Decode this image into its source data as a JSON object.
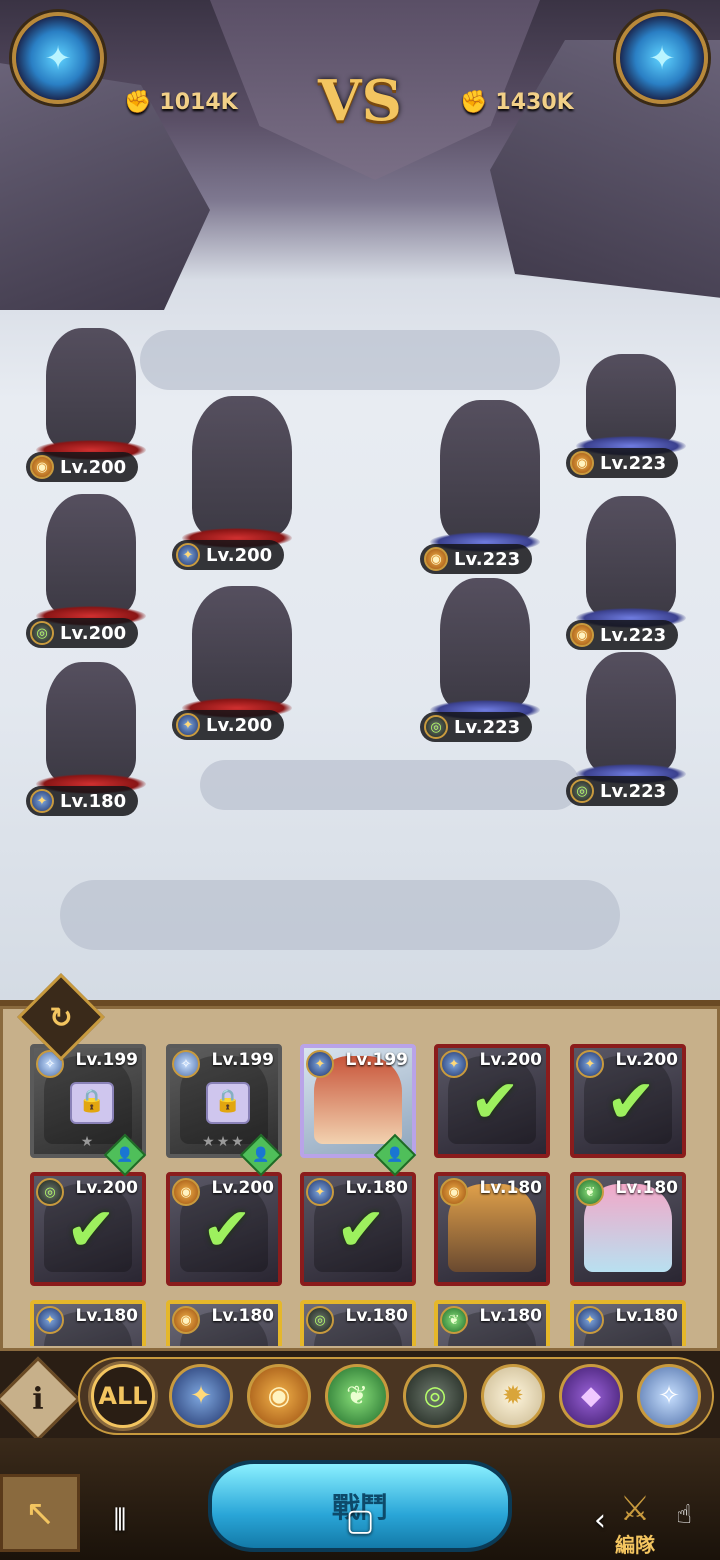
{
  "header": {
    "vs_label": "VS",
    "left_power": "1014K",
    "right_power": "1430K"
  },
  "allies": [
    {
      "level": "Lv.200",
      "faction": "mauler"
    },
    {
      "level": "Lv.200",
      "faction": "lightbearer"
    },
    {
      "level": "Lv.200",
      "faction": "graveborn"
    },
    {
      "level": "Lv.200",
      "faction": "lightbearer"
    },
    {
      "level": "Lv.180",
      "faction": "lightbearer"
    }
  ],
  "enemies": [
    {
      "level": "Lv.223",
      "faction": "mauler"
    },
    {
      "level": "Lv.223",
      "faction": "mauler"
    },
    {
      "level": "Lv.223",
      "faction": "mauler"
    },
    {
      "level": "Lv.223",
      "faction": "graveborn"
    },
    {
      "level": "Lv.223",
      "faction": "graveborn"
    }
  ],
  "roster": [
    {
      "level": "Lv.199",
      "state": "locked",
      "stars": "★",
      "assist": true
    },
    {
      "level": "Lv.199",
      "state": "locked",
      "stars": "★★★",
      "assist": true
    },
    {
      "level": "Lv.199",
      "state": "available",
      "stars": "",
      "assist": true
    },
    {
      "level": "Lv.200",
      "state": "selected",
      "stars": "",
      "assist": false
    },
    {
      "level": "Lv.200",
      "state": "selected",
      "stars": "",
      "assist": false
    },
    {
      "level": "Lv.200",
      "state": "selected",
      "stars": "",
      "assist": false
    },
    {
      "level": "Lv.200",
      "state": "selected",
      "stars": "",
      "assist": false
    },
    {
      "level": "Lv.180",
      "state": "selected",
      "stars": "",
      "assist": false
    },
    {
      "level": "Lv.180",
      "state": "available",
      "stars": "",
      "assist": false
    },
    {
      "level": "Lv.180",
      "state": "available",
      "stars": "",
      "assist": false
    },
    {
      "level": "Lv.180",
      "state": "available",
      "stars": "",
      "assist": false
    },
    {
      "level": "Lv.180",
      "state": "available",
      "stars": "",
      "assist": false
    },
    {
      "level": "Lv.180",
      "state": "available",
      "stars": "",
      "assist": false
    },
    {
      "level": "Lv.180",
      "state": "available",
      "stars": "",
      "assist": false
    },
    {
      "level": "Lv.180",
      "state": "available",
      "stars": "",
      "assist": false
    }
  ],
  "filters": {
    "all_label": "ALL",
    "items": [
      "lightbearer",
      "mauler",
      "wilder",
      "graveborn",
      "celestial",
      "hypogean",
      "dimensional"
    ]
  },
  "bottom": {
    "battle_label": "戰鬥",
    "formation_label": "編隊"
  }
}
